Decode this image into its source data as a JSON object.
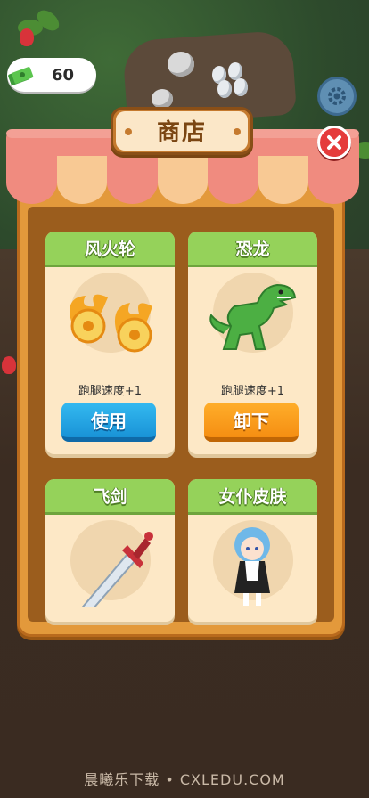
{
  "hud": {
    "money": "60"
  },
  "shop": {
    "title": "商店",
    "items": [
      {
        "name": "风火轮",
        "desc": "跑腿速度+1",
        "button": "使用",
        "button_color": "#1993d7"
      },
      {
        "name": "恐龙",
        "desc": "跑腿速度+1",
        "button": "卸下",
        "button_color": "#f58e12"
      },
      {
        "name": "飞剑"
      },
      {
        "name": "女仆皮肤"
      }
    ]
  },
  "watermark": "晨曦乐下载 • CXLEDU.COM",
  "colors": {
    "panel": "#e3993b",
    "card_header": "#95d25a",
    "close": "#e53b3b"
  }
}
